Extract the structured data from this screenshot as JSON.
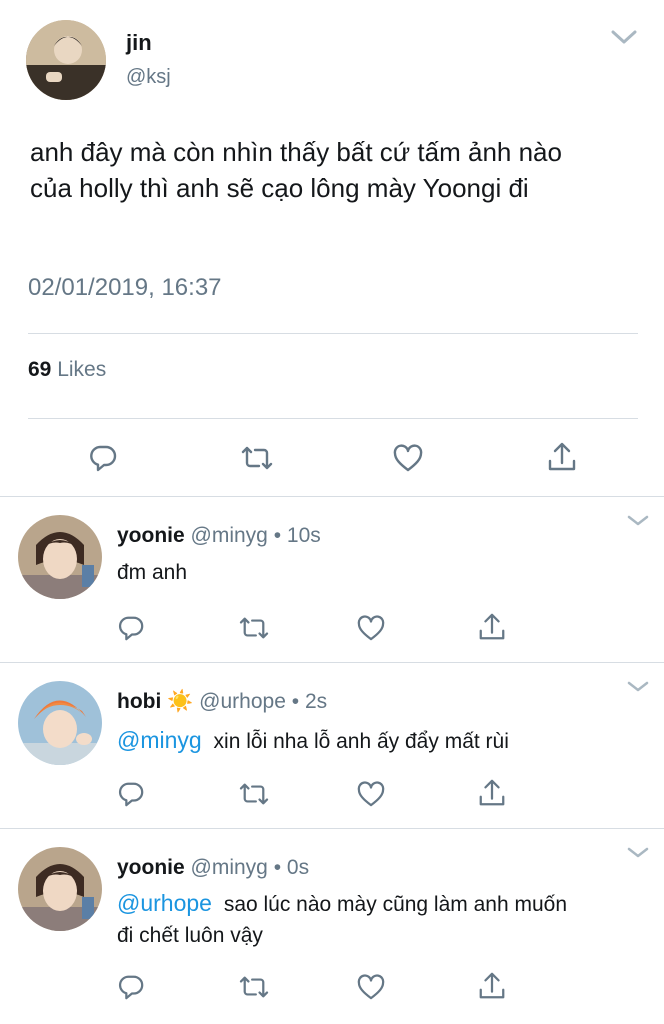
{
  "main_tweet": {
    "display_name": "jin",
    "handle": "@ksj",
    "text_line1": "anh đây mà còn nhìn thấy bất cứ tấm ảnh nào",
    "text_line2": "của holly thì anh sẽ cạo lông mày Yoongi đi",
    "timestamp": "02/01/2019, 16:37",
    "likes_count": "69",
    "likes_label": "Likes"
  },
  "replies": [
    {
      "display_name": "yoonie",
      "handle": "@minyg",
      "separator": "•",
      "time": "10s",
      "text": "đm anh"
    },
    {
      "display_name": "hobi",
      "emoji": "☀️",
      "handle": "@urhope",
      "separator": "•",
      "time": "2s",
      "mention": "@minyg",
      "text": "xin lỗi nha lỗ anh ấy đẩy mất rùi"
    },
    {
      "display_name": "yoonie",
      "handle": "@minyg",
      "separator": "•",
      "time": "0s",
      "mention": "@urhope",
      "text_line1": "sao lúc nào mày cũng làm anh muốn",
      "text_line2": "đi chết luôn vậy"
    }
  ],
  "icons": {
    "reply": "reply-icon",
    "retweet": "retweet-icon",
    "like": "heart-icon",
    "share": "share-icon",
    "menu": "chevron-down-icon"
  },
  "colors": {
    "link": "#1b95e0",
    "muted": "#657786",
    "text": "#14171a"
  }
}
